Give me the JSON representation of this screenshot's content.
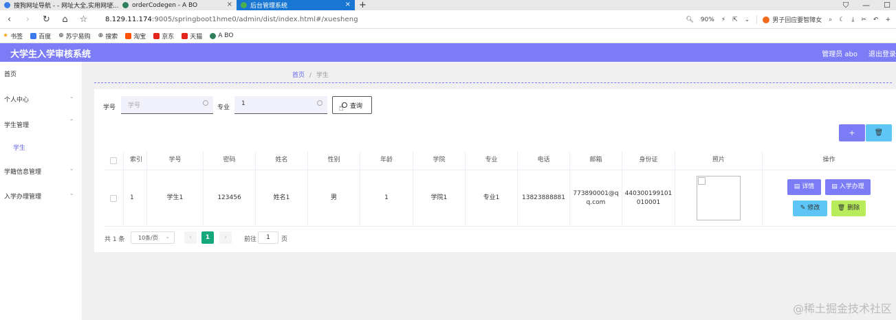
{
  "browser": {
    "tabs": [
      {
        "label": "搜狗网址导航 - - 网址大全,实用网址...",
        "icon_color": "#3b7be9"
      },
      {
        "label": "orderCodegen - A BO",
        "icon_color": "#2e7d5b"
      },
      {
        "label": "后台管理系统",
        "icon_color": "#4caf50",
        "active": true
      }
    ],
    "new_tab": "+",
    "url_host": "8.129.11.174",
    "url_path": ":9005/springboot1hme0/admin/dist/index.html#/xuesheng",
    "zoom": "90%",
    "search_text": "男子回应要智障女",
    "bookmarks": [
      {
        "label": "书签",
        "color": "#f5a623"
      },
      {
        "label": "百度",
        "color": "#3b7be9"
      },
      {
        "label": "苏宁易购",
        "color": "#888888"
      },
      {
        "label": "搜索",
        "color": "#888888"
      },
      {
        "label": "淘宝",
        "color": "#ff5000"
      },
      {
        "label": "京东",
        "color": "#e1251b"
      },
      {
        "label": "天猫",
        "color": "#e1251b"
      },
      {
        "label": "A BO",
        "color": "#2e7d5b"
      }
    ]
  },
  "app": {
    "title": "大学生入学审核系统",
    "user": "管理员 abo",
    "logout": "退出登录",
    "accent": "#7b7cf6"
  },
  "sidebar": {
    "items": [
      {
        "label": "首页"
      },
      {
        "label": "个人中心"
      },
      {
        "label": "学生管理"
      },
      {
        "label": "学籍信息管理"
      },
      {
        "label": "入学办理管理"
      }
    ],
    "sub_active": "学生"
  },
  "breadcrumb": {
    "home": "首页",
    "sep": "/",
    "current": "学生"
  },
  "search": {
    "xuehao_label": "学号",
    "xuehao_placeholder": "学号",
    "zhuanye_label": "专业",
    "zhuanye_value": "1",
    "query_button": "查询"
  },
  "table": {
    "headers": [
      "索引",
      "学号",
      "密码",
      "姓名",
      "性别",
      "年龄",
      "学院",
      "专业",
      "电话",
      "邮箱",
      "身份证",
      "照片",
      "操作"
    ],
    "rows": [
      {
        "index": "1",
        "xuehao": "学生1",
        "mima": "123456",
        "xingming": "姓名1",
        "xingbie": "男",
        "nianling": "1",
        "xueyuan": "学院1",
        "zhuanye": "专业1",
        "dianhua": "13823888881",
        "youxiang": "773890001@qq.com",
        "shenfenzheng": "440300199101010001",
        "actions": {
          "detail": "详情",
          "enroll": "入学办理",
          "edit": "修改",
          "delete": "删除"
        }
      }
    ]
  },
  "pagination": {
    "total": "共 1 条",
    "page_size": "10条/页",
    "current_page": "1",
    "goto_label": "前往",
    "goto_value": "1",
    "page_unit": "页"
  },
  "watermark": "@稀土掘金技术社区"
}
